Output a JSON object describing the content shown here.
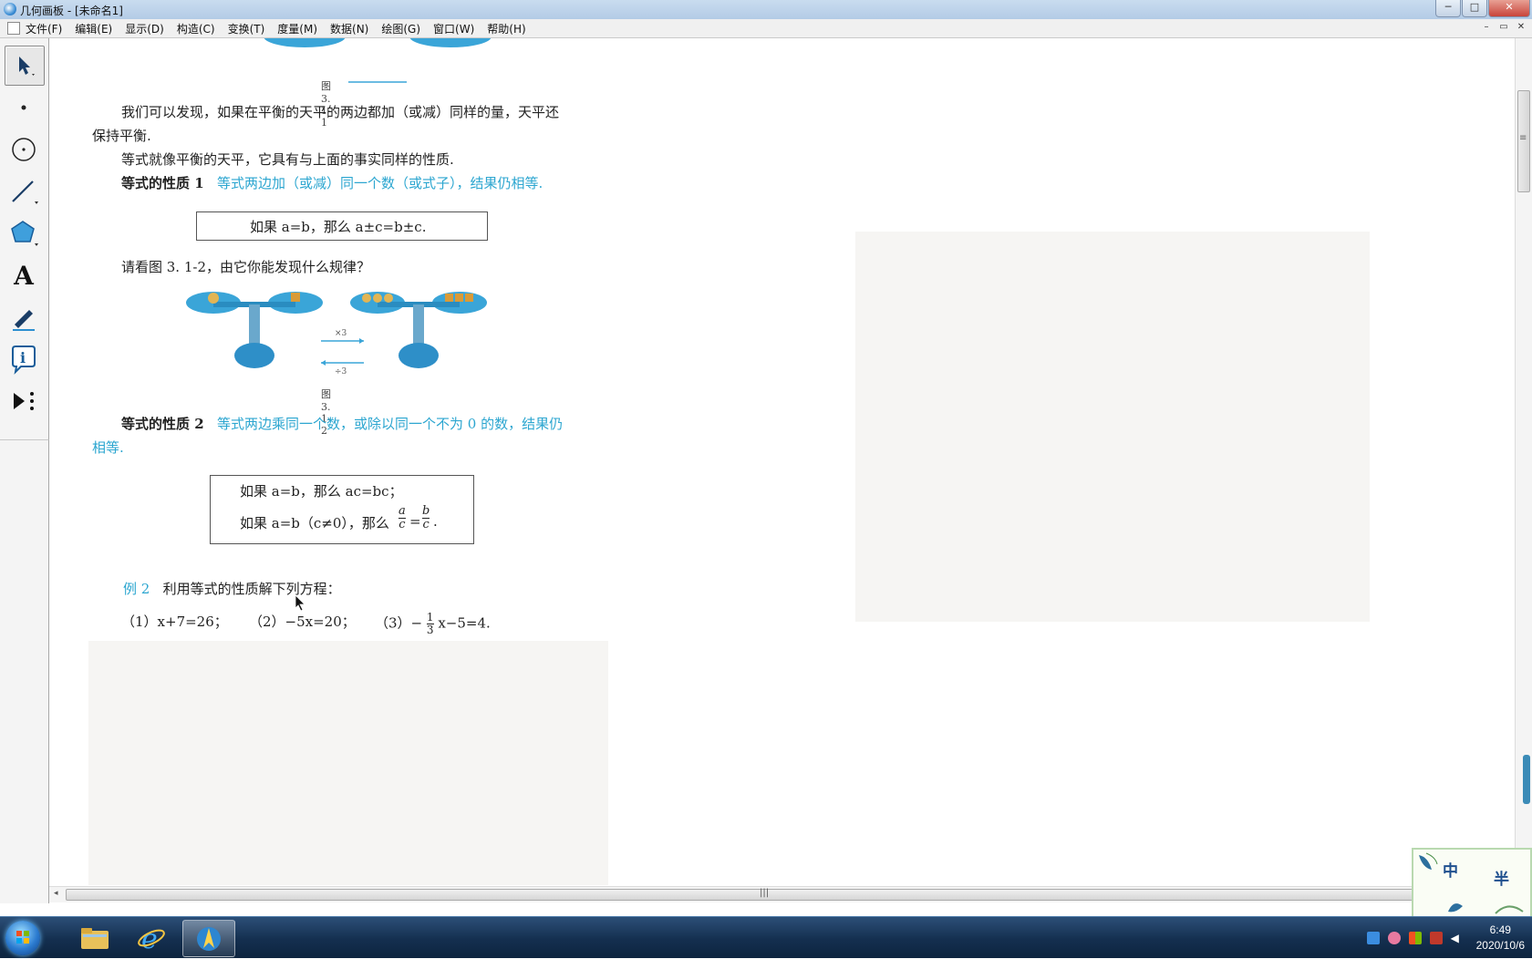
{
  "window": {
    "title": "几何画板 - [未命名1]",
    "buttons": {
      "minimize": "─",
      "maximize": "□",
      "close": "✕"
    }
  },
  "menu": {
    "items": [
      "文件(F)",
      "编辑(E)",
      "显示(D)",
      "构造(C)",
      "变换(T)",
      "度量(M)",
      "数据(N)",
      "绘图(G)",
      "窗口(W)",
      "帮助(H)"
    ],
    "mdi_buttons": {
      "minimize": "–",
      "restore": "▭",
      "close": "✕"
    }
  },
  "toolbox": {
    "tools": [
      "arrow-select-tool",
      "point-tool",
      "compass-tool",
      "straightedge-tool",
      "polygon-tool",
      "text-tool",
      "marker-tool",
      "information-tool",
      "custom-tools"
    ],
    "text_tool_glyph": "A"
  },
  "content": {
    "fig1_caption": "图 3. 1-1",
    "p1_line1": "我们可以发现，如果在平衡的天平的两边都加（或减）同样的量，天平还",
    "p1_line2": "保持平衡.",
    "p2": "等式就像平衡的天平，它具有与上面的事实同样的性质.",
    "prop1_label": "等式的性质 1",
    "prop1_text": "等式两边加（或减）同一个数（或式子），结果仍相等.",
    "box1": "如果 a=b，那么 a±c=b±c.",
    "q": "请看图 3. 1-2，由它你能发现什么规律？",
    "fig2_times": "×3",
    "fig2_div": "÷3",
    "fig2_caption": "图 3. 1-2",
    "prop2_label": "等式的性质 2",
    "prop2_text_line1": "等式两边乘同一个数，或除以同一个不为 0 的数，结果仍",
    "prop2_text_line2": "相等.",
    "box2_line1": "如果 a=b，那么 ac=bc；",
    "box2_line2_prefix": "如果 a=b（c≠0），那么",
    "frac_a": "a",
    "frac_b": "b",
    "frac_c": "c",
    "ex_label": "例 2",
    "ex_text": "利用等式的性质解下列方程：",
    "ex_eq1": "（1）x+7=26；",
    "ex_eq2": "（2）−5x=20；",
    "ex_eq3_prefix": "（3）−",
    "ex_eq3_num": "1",
    "ex_eq3_den": "3",
    "ex_eq3_suffix": "x−5=4."
  },
  "badge": {
    "char1": "中",
    "char2": "半"
  },
  "taskbar": {
    "apps": [
      "explorer",
      "internet-explorer",
      "geometers-sketchpad"
    ],
    "time": "6:49",
    "date": "2020/10/6"
  },
  "colors": {
    "accent_blue": "#2ca6d0",
    "balance_blue": "#3aa5d8",
    "taskbar": "#142f4f"
  }
}
